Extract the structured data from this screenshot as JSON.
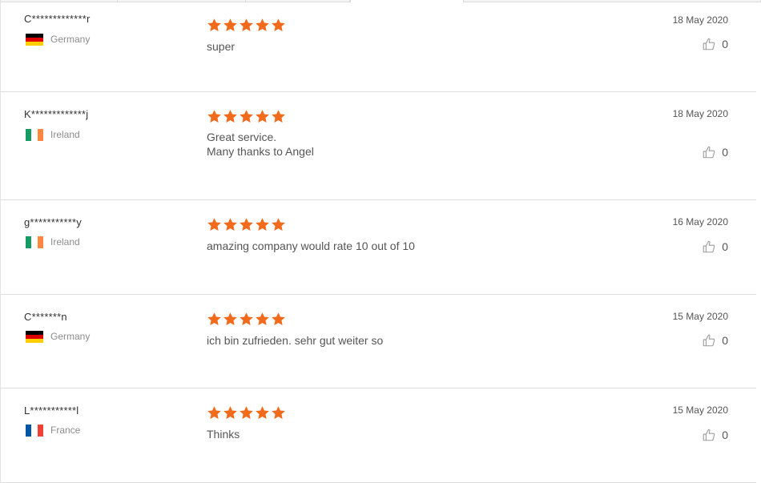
{
  "colors": {
    "star": "#f26a1b",
    "divider": "#dedede",
    "text": "#555555",
    "muted": "#8c8c8c"
  },
  "reviews": [
    {
      "name": "C*************r",
      "country": "Germany",
      "flag": "germany-flag",
      "rating": 5,
      "date": "18 May 2020",
      "comment_lines": [
        "super"
      ],
      "likes": "0"
    },
    {
      "name": "K*************j",
      "country": "Ireland",
      "flag": "ireland-flag",
      "rating": 5,
      "date": "18 May 2020",
      "comment_lines": [
        "Great service.",
        "Many thanks to Angel"
      ],
      "likes": "0"
    },
    {
      "name": "g***********y",
      "country": "Ireland",
      "flag": "ireland-flag",
      "rating": 5,
      "date": "16 May 2020",
      "comment_lines": [
        "amazing company would rate 10 out of 10"
      ],
      "likes": "0"
    },
    {
      "name": "C*******n",
      "country": "Germany",
      "flag": "germany-flag",
      "rating": 5,
      "date": "15 May 2020",
      "comment_lines": [
        "ich bin zufrieden. sehr gut weiter so"
      ],
      "likes": "0"
    },
    {
      "name": "L***********l",
      "country": "France",
      "flag": "france-flag",
      "rating": 5,
      "date": "15 May 2020",
      "comment_lines": [
        "Thinks"
      ],
      "likes": "0"
    }
  ]
}
